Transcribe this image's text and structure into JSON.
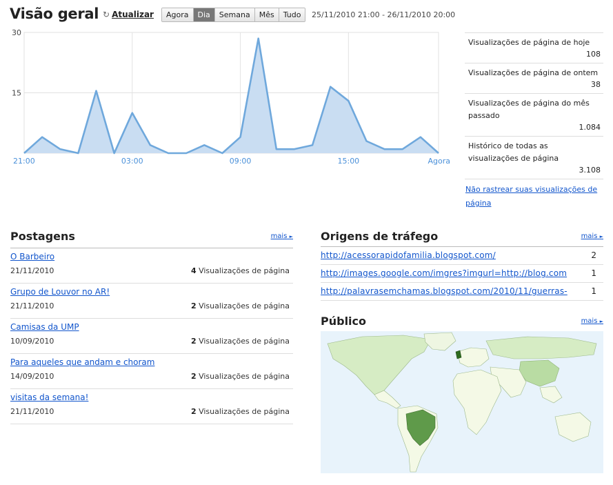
{
  "header": {
    "title": "Visão geral",
    "refresh_label": "Atualizar",
    "range_buttons": [
      "Agora",
      "Dia",
      "Semana",
      "Mês",
      "Tudo"
    ],
    "active_range": "Dia",
    "date_range": "25/11/2010 21:00 - 26/11/2010 20:00"
  },
  "chart_data": {
    "type": "area",
    "y_ticks": [
      "30",
      "15"
    ],
    "ylim": [
      0,
      30
    ],
    "x_tick_labels": [
      "21:00",
      "03:00",
      "09:00",
      "15:00",
      "Agora"
    ],
    "values": [
      0,
      4,
      1,
      0,
      15.5,
      0,
      10,
      2,
      0,
      0,
      2,
      0,
      4,
      28.5,
      1,
      1,
      2,
      16.5,
      13,
      3,
      1,
      1,
      4,
      0
    ],
    "colors": {
      "line": "#6fa8dc",
      "fill": "#c9ddf2",
      "grid": "#e2e2e2",
      "tick": "#4a90d9"
    }
  },
  "stats": [
    {
      "label": "Visualizações de página de hoje",
      "value": "108"
    },
    {
      "label": "Visualizações de página de ontem",
      "value": "38"
    },
    {
      "label": "Visualizações de página do mês passado",
      "value": "1.084"
    },
    {
      "label": "Histórico de todas as visualizações de página",
      "value": "3.108"
    }
  ],
  "no_track_link": "Não rastrear suas visualizações de página",
  "posts": {
    "title": "Postagens",
    "more": "mais",
    "views_suffix": "Visualizações de página",
    "items": [
      {
        "title": "O Barbeiro",
        "date": "21/11/2010",
        "views": "4"
      },
      {
        "title": "Grupo de Louvor no AR!",
        "date": "21/11/2010",
        "views": "2"
      },
      {
        "title": "Camisas da UMP",
        "date": "10/09/2010",
        "views": "2"
      },
      {
        "title": "Para aqueles que andam e choram",
        "date": "14/09/2010",
        "views": "2"
      },
      {
        "title": "visitas da semana!",
        "date": "21/11/2010",
        "views": "2"
      }
    ]
  },
  "traffic": {
    "title": "Origens de tráfego",
    "more": "mais",
    "items": [
      {
        "url": "http://acessorapidofamilia.blogspot.com/",
        "count": "2"
      },
      {
        "url": "http://images.google.com/imgres?imgurl=http://blog.com",
        "count": "1"
      },
      {
        "url": "http://palavrasemchamas.blogspot.com/2010/11/guerras-",
        "count": "1"
      }
    ]
  },
  "audience": {
    "title": "Público",
    "more": "mais",
    "colors": {
      "ocean": "#e8f3fb",
      "land": "#f4f9e6",
      "light": "#d6ecc4",
      "mid": "#b9dca3",
      "brazil": "#5f9a4a",
      "uk": "#2d6a1f"
    }
  }
}
